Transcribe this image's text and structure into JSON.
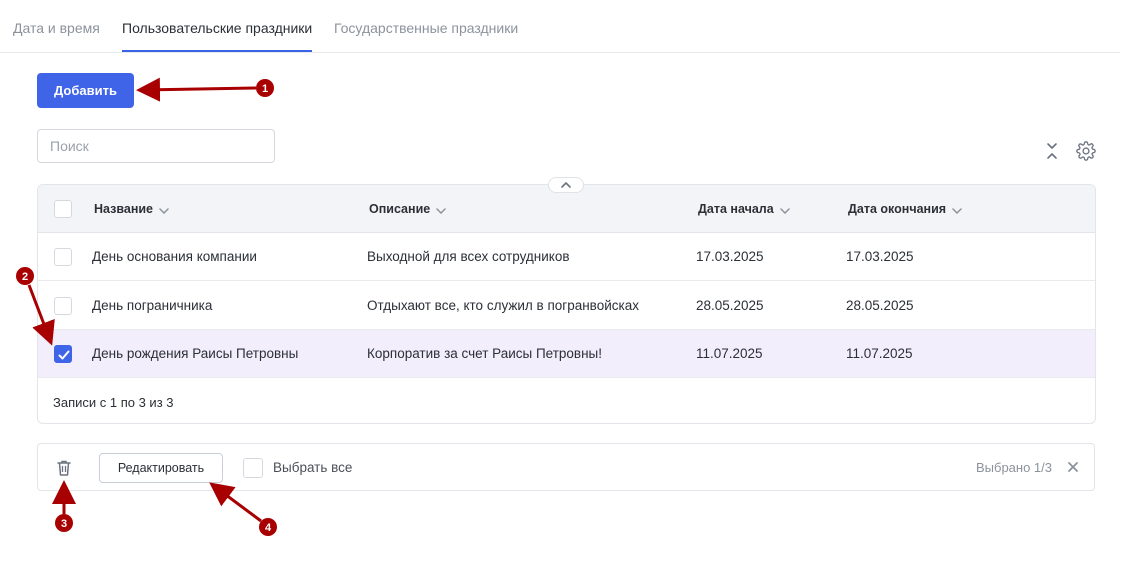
{
  "tabs": [
    {
      "label": "Дата и время",
      "active": false
    },
    {
      "label": "Пользовательские праздники",
      "active": true
    },
    {
      "label": "Государственные праздники",
      "active": false
    }
  ],
  "toolbar": {
    "add_label": "Добавить",
    "search_placeholder": "Поиск"
  },
  "table": {
    "columns": [
      "Название",
      "Описание",
      "Дата начала",
      "Дата окончания"
    ],
    "rows": [
      {
        "name": "День основания компании",
        "description": "Выходной для всех сотрудников",
        "start": "17.03.2025",
        "end": "17.03.2025",
        "checked": false
      },
      {
        "name": "День пограничника",
        "description": "Отдыхают все, кто служил в погранвойсках",
        "start": "28.05.2025",
        "end": "28.05.2025",
        "checked": false
      },
      {
        "name": "День рождения Раисы Петровны",
        "description": "Корпоратив за счет Раисы Петровны!",
        "start": "11.07.2025",
        "end": "11.07.2025",
        "checked": true
      }
    ],
    "footer": "Записи с 1 по 3 из 3"
  },
  "actionbar": {
    "edit_label": "Редактировать",
    "select_all_label": "Выбрать все",
    "selected_count": "Выбрано 1/3"
  },
  "annotations": [
    "1",
    "2",
    "3",
    "4"
  ],
  "colors": {
    "accent": "#3f64e8",
    "selected_row": "#f3eefc",
    "annotation": "#b00000"
  },
  "icons": [
    "collapse-icon",
    "settings-icon",
    "chevron-down-icon",
    "chevron-up-icon",
    "check-icon",
    "trash-icon",
    "close-icon"
  ]
}
